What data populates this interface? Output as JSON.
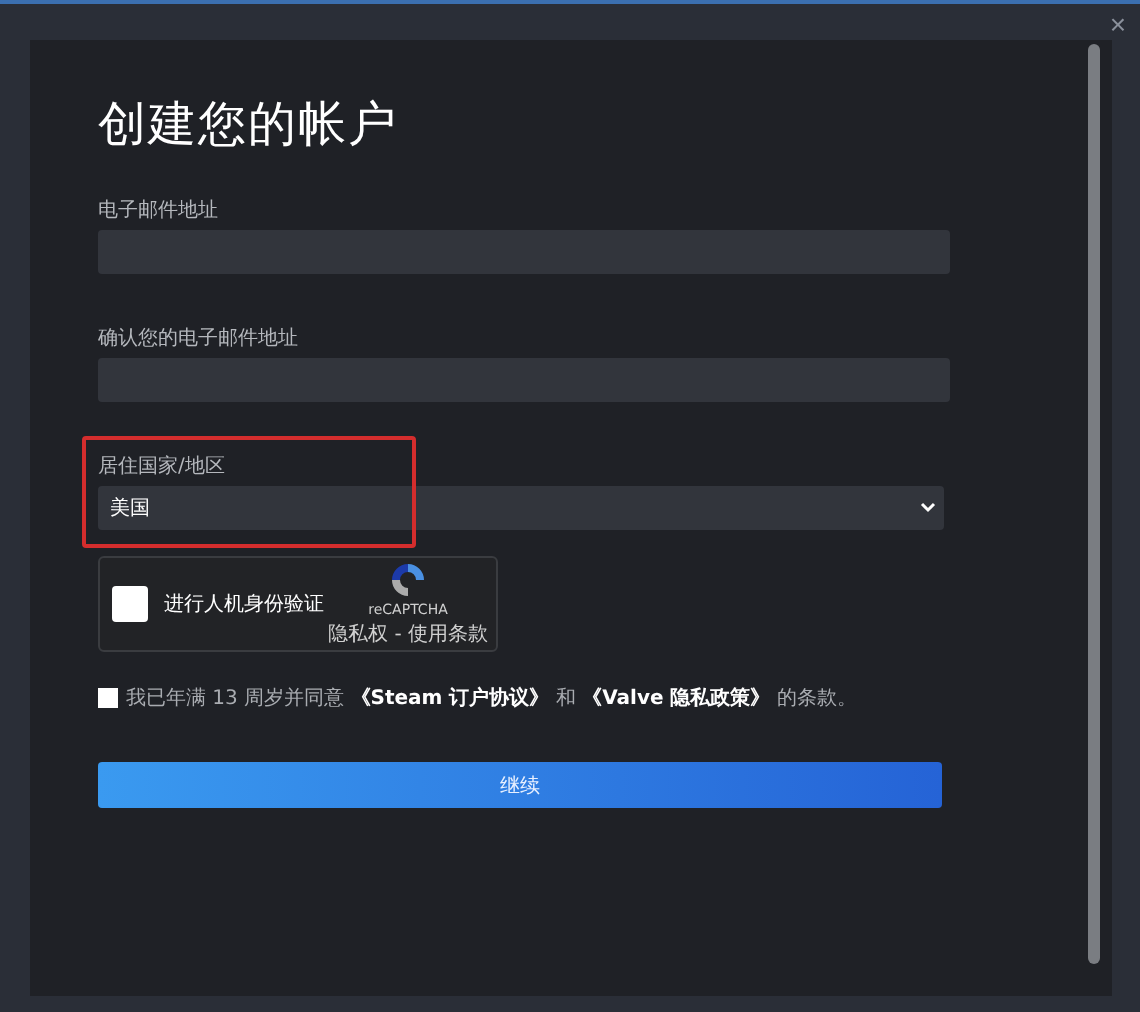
{
  "dialog": {
    "close": "×",
    "title": "创建您的帐户"
  },
  "fields": [
    {
      "kind": "text",
      "label": "电子邮件地址"
    },
    {
      "kind": "text",
      "label": "确认您的电子邮件地址"
    },
    {
      "kind": "select",
      "label": "居住国家/地区",
      "value": "美国",
      "highlighted": true
    }
  ],
  "captcha": {
    "checked": false,
    "label": "进行人机身份验证",
    "brand": "reCAPTCHA",
    "links": "隐私权 - 使用条款"
  },
  "agreement": {
    "checked": false,
    "prefix": "我已年满 13 周岁并同意",
    "link_1": "《Steam 订户协议》",
    "middle": "和",
    "link_2": "《Valve 隐私政策》",
    "suffix": "的条款。"
  },
  "submit": {
    "label": "继续"
  }
}
